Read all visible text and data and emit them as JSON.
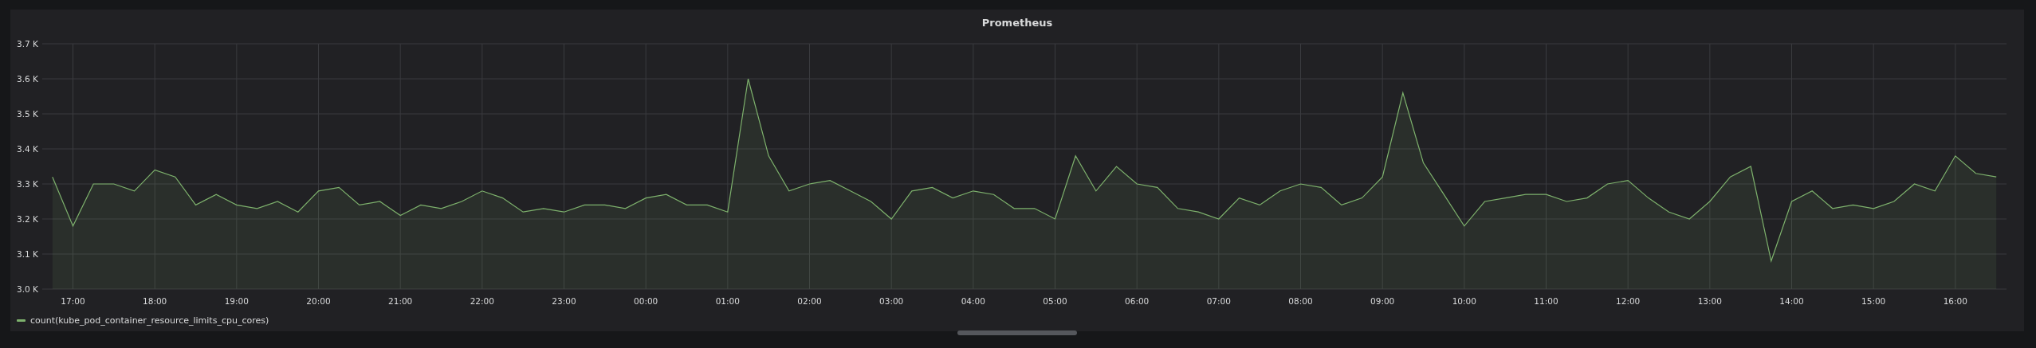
{
  "panel": {
    "title": "Prometheus",
    "chart_data": {
      "type": "area",
      "grid": true,
      "ylim": [
        3000,
        3700
      ],
      "yticks": [
        {
          "value": 3000,
          "label": "3.0 K"
        },
        {
          "value": 3100,
          "label": "3.1 K"
        },
        {
          "value": 3200,
          "label": "3.2 K"
        },
        {
          "value": 3300,
          "label": "3.3 K"
        },
        {
          "value": 3400,
          "label": "3.4 K"
        },
        {
          "value": 3500,
          "label": "3.5 K"
        },
        {
          "value": 3600,
          "label": "3.6 K"
        },
        {
          "value": 3700,
          "label": "3.7 K"
        }
      ],
      "categories": [
        null,
        "17:00",
        null,
        null,
        null,
        "18:00",
        null,
        null,
        null,
        "19:00",
        null,
        null,
        null,
        "20:00",
        null,
        null,
        null,
        "21:00",
        null,
        null,
        null,
        "22:00",
        null,
        null,
        null,
        "23:00",
        null,
        null,
        null,
        "00:00",
        null,
        null,
        null,
        "01:00",
        null,
        null,
        null,
        "02:00",
        null,
        null,
        null,
        "03:00",
        null,
        null,
        null,
        "04:00",
        null,
        null,
        null,
        "05:00",
        null,
        null,
        null,
        "06:00",
        null,
        null,
        null,
        "07:00",
        null,
        null,
        null,
        "08:00",
        null,
        null,
        null,
        "09:00",
        null,
        null,
        null,
        "10:00",
        null,
        null,
        null,
        "11:00",
        null,
        null,
        null,
        "12:00",
        null,
        null,
        null,
        "13:00",
        null,
        null,
        null,
        "14:00",
        null,
        null,
        null,
        "15:00",
        null,
        null,
        null,
        "16:00",
        null,
        null
      ],
      "series": [
        {
          "name": "count(kube_pod_container_resource_limits_cpu_cores)",
          "color": "#7eb26d",
          "values": [
            3320,
            3180,
            3300,
            3300,
            3280,
            3340,
            3320,
            3240,
            3270,
            3240,
            3230,
            3250,
            3220,
            3280,
            3290,
            3240,
            3250,
            3210,
            3240,
            3230,
            3250,
            3280,
            3260,
            3220,
            3230,
            3220,
            3240,
            3240,
            3230,
            3260,
            3270,
            3240,
            3240,
            3220,
            3600,
            3380,
            3280,
            3300,
            3310,
            3280,
            3250,
            3200,
            3280,
            3290,
            3260,
            3280,
            3270,
            3230,
            3230,
            3200,
            3380,
            3280,
            3350,
            3300,
            3290,
            3230,
            3220,
            3200,
            3260,
            3240,
            3280,
            3300,
            3290,
            3240,
            3260,
            3320,
            3560,
            3360,
            3270,
            3180,
            3250,
            3260,
            3270,
            3270,
            3250,
            3260,
            3300,
            3310,
            3260,
            3220,
            3200,
            3250,
            3320,
            3350,
            3080,
            3250,
            3280,
            3230,
            3240,
            3230,
            3250,
            3300,
            3280,
            3380,
            3330,
            3320
          ]
        }
      ]
    }
  }
}
